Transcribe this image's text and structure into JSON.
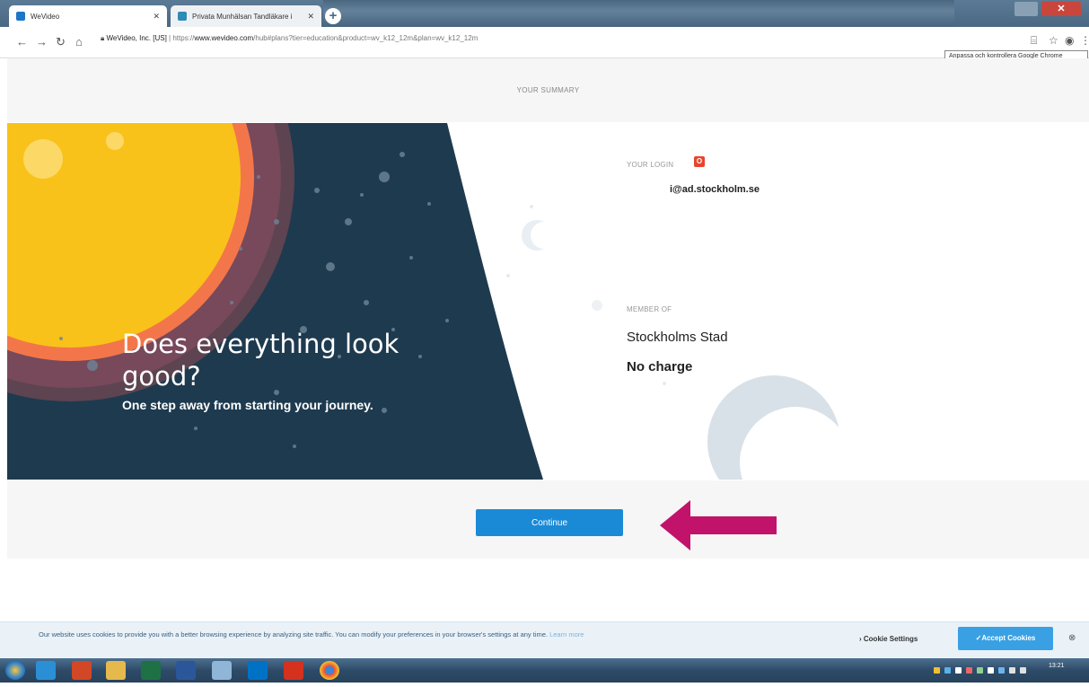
{
  "browser": {
    "tabs": [
      {
        "label": "WeVideo",
        "active": true
      },
      {
        "label": "Privata Munhälsan Tandläkare i",
        "active": false
      }
    ],
    "url_host": "WeVideo, Inc. [US]",
    "url_prefix": "https://",
    "url_domain": "www.wevideo.com",
    "url_path": "/hub#plans?tier=education&product=wv_k12_12m&plan=wv_k12_12m",
    "tooltip": "Anpassa och kontrollera Google Chrome"
  },
  "page": {
    "header": "YOUR SUMMARY",
    "hero_title": "Does everything look good?",
    "hero_subtitle": "One step away from starting your journey.",
    "login_label": "YOUR LOGIN",
    "login_value": "i@ad.stockholm.se",
    "member_label": "MEMBER OF",
    "member_value": "Stockholms Stad",
    "charge_value": "No charge",
    "continue_label": "Continue"
  },
  "cookie_banner": {
    "text": "Our website uses cookies to provide you with a better browsing experience by analyzing site traffic. You can modify your preferences in your browser's settings at any time.",
    "learn_more": "Learn more",
    "settings_label": "› Cookie Settings",
    "accept_label": "✓Accept Cookies",
    "close_label": "⊗"
  },
  "taskbar": {
    "time": "13:21"
  },
  "colors": {
    "hero_bg": "#1e3a4f",
    "accent_button": "#1a8ad6",
    "arrow": "#c2136b",
    "sun": "#f9c21a"
  }
}
